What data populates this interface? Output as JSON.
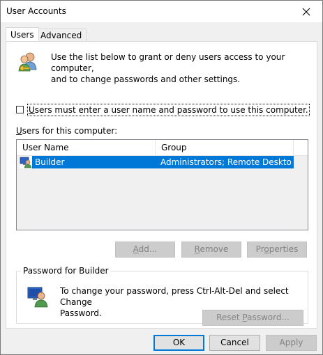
{
  "window": {
    "title": "User Accounts"
  },
  "tabs": [
    {
      "label": "Users",
      "active": true
    },
    {
      "label": "Advanced",
      "active": false
    }
  ],
  "users_tab": {
    "intro_line1": "Use the list below to grant or deny users access to your computer,",
    "intro_line2": "and to change passwords and other settings.",
    "require_login": {
      "pre": "",
      "access_key": "U",
      "post": "sers must enter a user name and password to use this computer.",
      "checked": false
    },
    "list_label": {
      "access_key": "U",
      "post": "sers for this computer:"
    },
    "columns": [
      "User Name",
      "Group"
    ],
    "rows": [
      {
        "user": "Builder",
        "group": "Administrators; Remote Desktop ...",
        "selected": true
      }
    ],
    "buttons": {
      "add": {
        "access_key": "A",
        "post": "dd...",
        "enabled": false
      },
      "remove": {
        "access_key": "R",
        "post": "emove",
        "enabled": false
      },
      "properties": {
        "pre": "Pr",
        "access_key": "o",
        "post": "perties",
        "enabled": false
      }
    },
    "password_group": {
      "title": "Password for Builder",
      "line1": "To change your password, press Ctrl-Alt-Del and select Change",
      "line2": "Password.",
      "reset_button": {
        "pre": "Reset ",
        "access_key": "P",
        "post": "assword...",
        "enabled": false
      }
    }
  },
  "dialog_buttons": {
    "ok": "OK",
    "cancel": "Cancel",
    "apply": "Apply",
    "apply_enabled": false
  },
  "colors": {
    "selection": "#0078d7",
    "dialog_bg": "#f0f0f0",
    "panel_bg": "#ffffff",
    "disabled_text": "#838383"
  }
}
